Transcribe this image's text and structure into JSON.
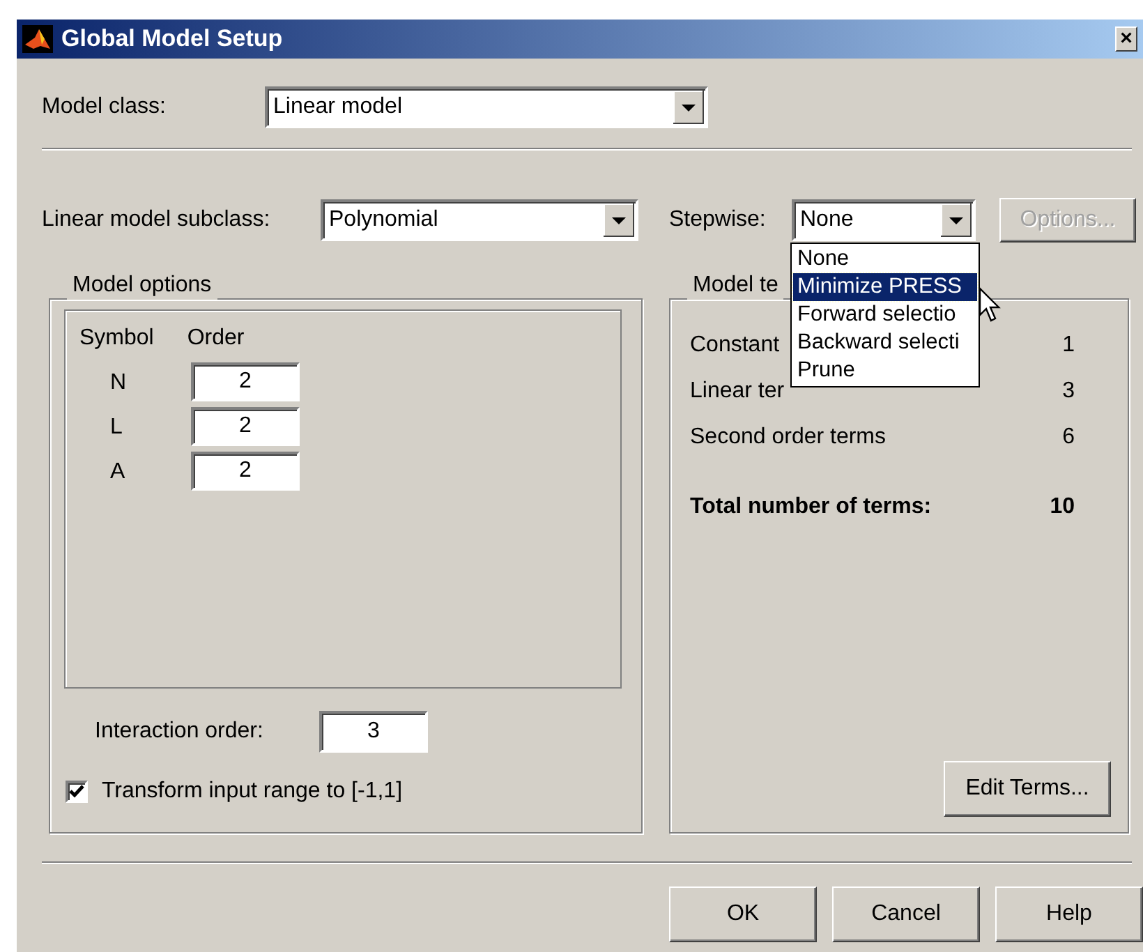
{
  "window": {
    "title": "Global Model Setup",
    "close": "×"
  },
  "model_class": {
    "label": "Model class:",
    "value": "Linear model"
  },
  "subclass": {
    "label": "Linear model subclass:",
    "value": "Polynomial"
  },
  "stepwise": {
    "label": "Stepwise:",
    "value": "None",
    "expanded": true,
    "options": [
      {
        "label": "None",
        "highlighted": false
      },
      {
        "label": "Minimize PRESS",
        "highlighted": true
      },
      {
        "label": "Forward selectio",
        "highlighted": false
      },
      {
        "label": "Backward selecti",
        "highlighted": false
      },
      {
        "label": "Prune",
        "highlighted": false
      }
    ]
  },
  "options_button": {
    "label": "Options...",
    "disabled": true
  },
  "model_options": {
    "legend": "Model options",
    "columns": [
      "Symbol",
      "Order"
    ],
    "rows": [
      {
        "symbol": "N",
        "order": "2"
      },
      {
        "symbol": "L",
        "order": "2"
      },
      {
        "symbol": "A",
        "order": "2"
      }
    ],
    "interaction": {
      "label": "Interaction order:",
      "value": "3"
    },
    "transform": {
      "label": "Transform input range to [-1,1]",
      "checked": true
    }
  },
  "model_terms": {
    "legend": "Model te",
    "rows": [
      {
        "label": "Constant",
        "value": "1"
      },
      {
        "label": "Linear ter",
        "value": "3"
      },
      {
        "label": "Second order terms",
        "value": "6"
      }
    ],
    "total": {
      "label": "Total number of terms:",
      "value": "10"
    },
    "edit_button": "Edit Terms..."
  },
  "buttons": [
    "OK",
    "Cancel",
    "Help"
  ]
}
